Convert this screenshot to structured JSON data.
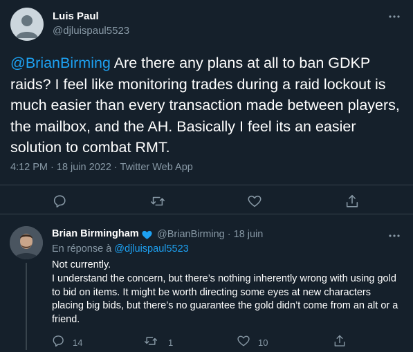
{
  "tweet": {
    "author_name": "Luis Paul",
    "author_handle": "@djluispaul5523",
    "mention": "@BrianBirming",
    "text": " Are there any plans at all to ban GDKP raids? I feel like monitoring trades during a raid lockout is much easier than every transaction made between players, the mailbox, and the AH. Basically I feel its an easier solution to combat RMT.",
    "meta": "4:12 PM · 18 juin 2022 · Twitter Web App",
    "actions": [
      "reply-icon",
      "retweet-icon",
      "like-icon",
      "share-icon"
    ]
  },
  "reply": {
    "author_name": "Brian Birmingham",
    "author_handle": "@BrianBirming",
    "dot": " · ",
    "date": "18 juin",
    "reply_prefix": "En réponse à ",
    "reply_to": "@djluispaul5523",
    "line1": "Not currently.",
    "line2": "I understand the concern, but there’s nothing inherently wrong with using gold to bid on items.  It might be worth directing some eyes at new characters placing big bids, but there’s no guarantee the gold didn’t come from an alt or a friend.",
    "reply_count": "14",
    "retweet_count": "1",
    "like_count": "10"
  },
  "colors": {
    "background": "#15202b",
    "accent": "#1da1f2",
    "muted": "#8899a6",
    "divider": "#38444d"
  }
}
